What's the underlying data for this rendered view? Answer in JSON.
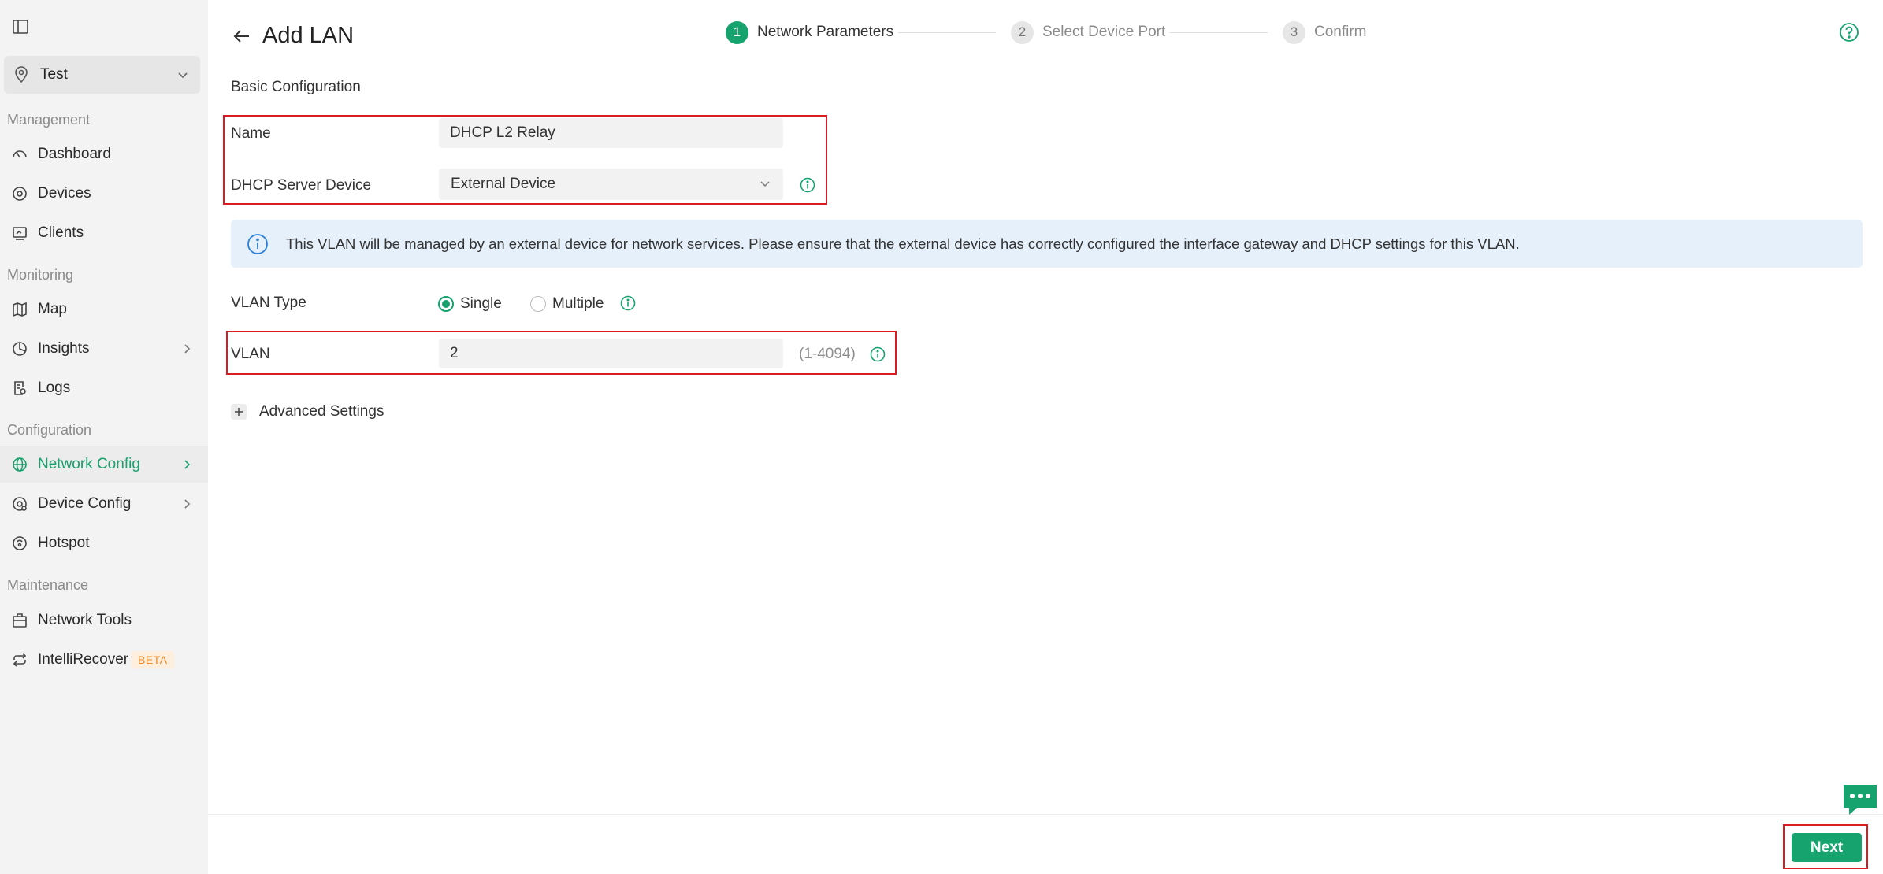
{
  "sidebar": {
    "site": "Test",
    "sections": {
      "management": "Management",
      "monitoring": "Monitoring",
      "configuration": "Configuration",
      "maintenance": "Maintenance"
    },
    "items": {
      "dashboard": "Dashboard",
      "devices": "Devices",
      "clients": "Clients",
      "map": "Map",
      "insights": "Insights",
      "logs": "Logs",
      "network_config": "Network Config",
      "device_config": "Device Config",
      "hotspot": "Hotspot",
      "network_tools": "Network Tools",
      "intellirecover": "IntelliRecover",
      "beta_badge": "BETA"
    },
    "active_item": "Network Config",
    "accent_color": "#1aa06d"
  },
  "header": {
    "title": "Add LAN",
    "steps": [
      {
        "num": "1",
        "label": "Network Parameters"
      },
      {
        "num": "2",
        "label": "Select Device Port"
      },
      {
        "num": "3",
        "label": "Confirm"
      }
    ],
    "current_step": 1
  },
  "form": {
    "section_title": "Basic Configuration",
    "name_label": "Name",
    "name_value": "DHCP L2 Relay",
    "dhcp_label": "DHCP Server Device",
    "dhcp_value": "External Device",
    "banner_text": "This VLAN will be managed by an external device for network services. Please ensure that the external device has correctly configured the interface gateway and DHCP settings for this VLAN.",
    "vlan_type_label": "VLAN Type",
    "vlan_type_options": [
      "Single",
      "Multiple"
    ],
    "vlan_type_selected": "Single",
    "vlan_label": "VLAN",
    "vlan_value": "2",
    "vlan_range": "(1-4094)",
    "advanced_label": "Advanced Settings"
  },
  "footer": {
    "next_label": "Next"
  },
  "colors": {
    "primary": "#16a36e",
    "highlight_box": "#d91c22",
    "banner_bg": "#e5f0fb"
  }
}
